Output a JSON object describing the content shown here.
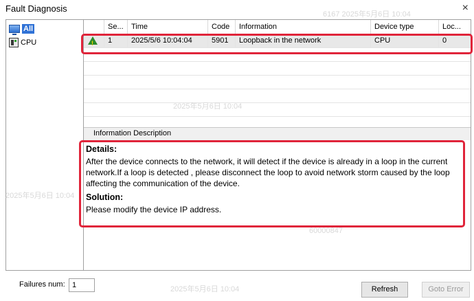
{
  "window": {
    "title": "Fault Diagnosis",
    "close_glyph": "×"
  },
  "tree": {
    "items": [
      {
        "label": "All",
        "icon": "monitor-icon",
        "selected": true
      },
      {
        "label": "CPU",
        "icon": "cpu-icon",
        "selected": false
      }
    ]
  },
  "table": {
    "columns": [
      "Se...",
      "Time",
      "Code",
      "Information",
      "Device type",
      "Loc..."
    ],
    "rows": [
      {
        "seq": "1",
        "time": "2025/5/6 10:04:04",
        "code": "5901",
        "information": "Loopback in the network",
        "device_type": "CPU",
        "location": "0"
      }
    ]
  },
  "description": {
    "section_title": "Information Description",
    "details_heading": "Details:",
    "details_text": "After the device connects to the network, it will detect if the device is already in a loop in the current network.If a loop is detected , please disconnect the loop to avoid network storm caused by the loop affecting the communication of the device.",
    "solution_heading": "Solution:",
    "solution_text": "Please modify the device IP address."
  },
  "footer": {
    "failures_label": "Failures num:",
    "failures_value": "1",
    "refresh_label": "Refresh",
    "goto_error_label": "Goto Error"
  },
  "watermarks": [
    "2025年5月6日 10:04",
    "6167 2025年5月6日 10:04",
    "60000847"
  ],
  "colors": {
    "highlight": "#e0243a",
    "selection": "#3072d6",
    "warning": "#2a8a2a"
  }
}
